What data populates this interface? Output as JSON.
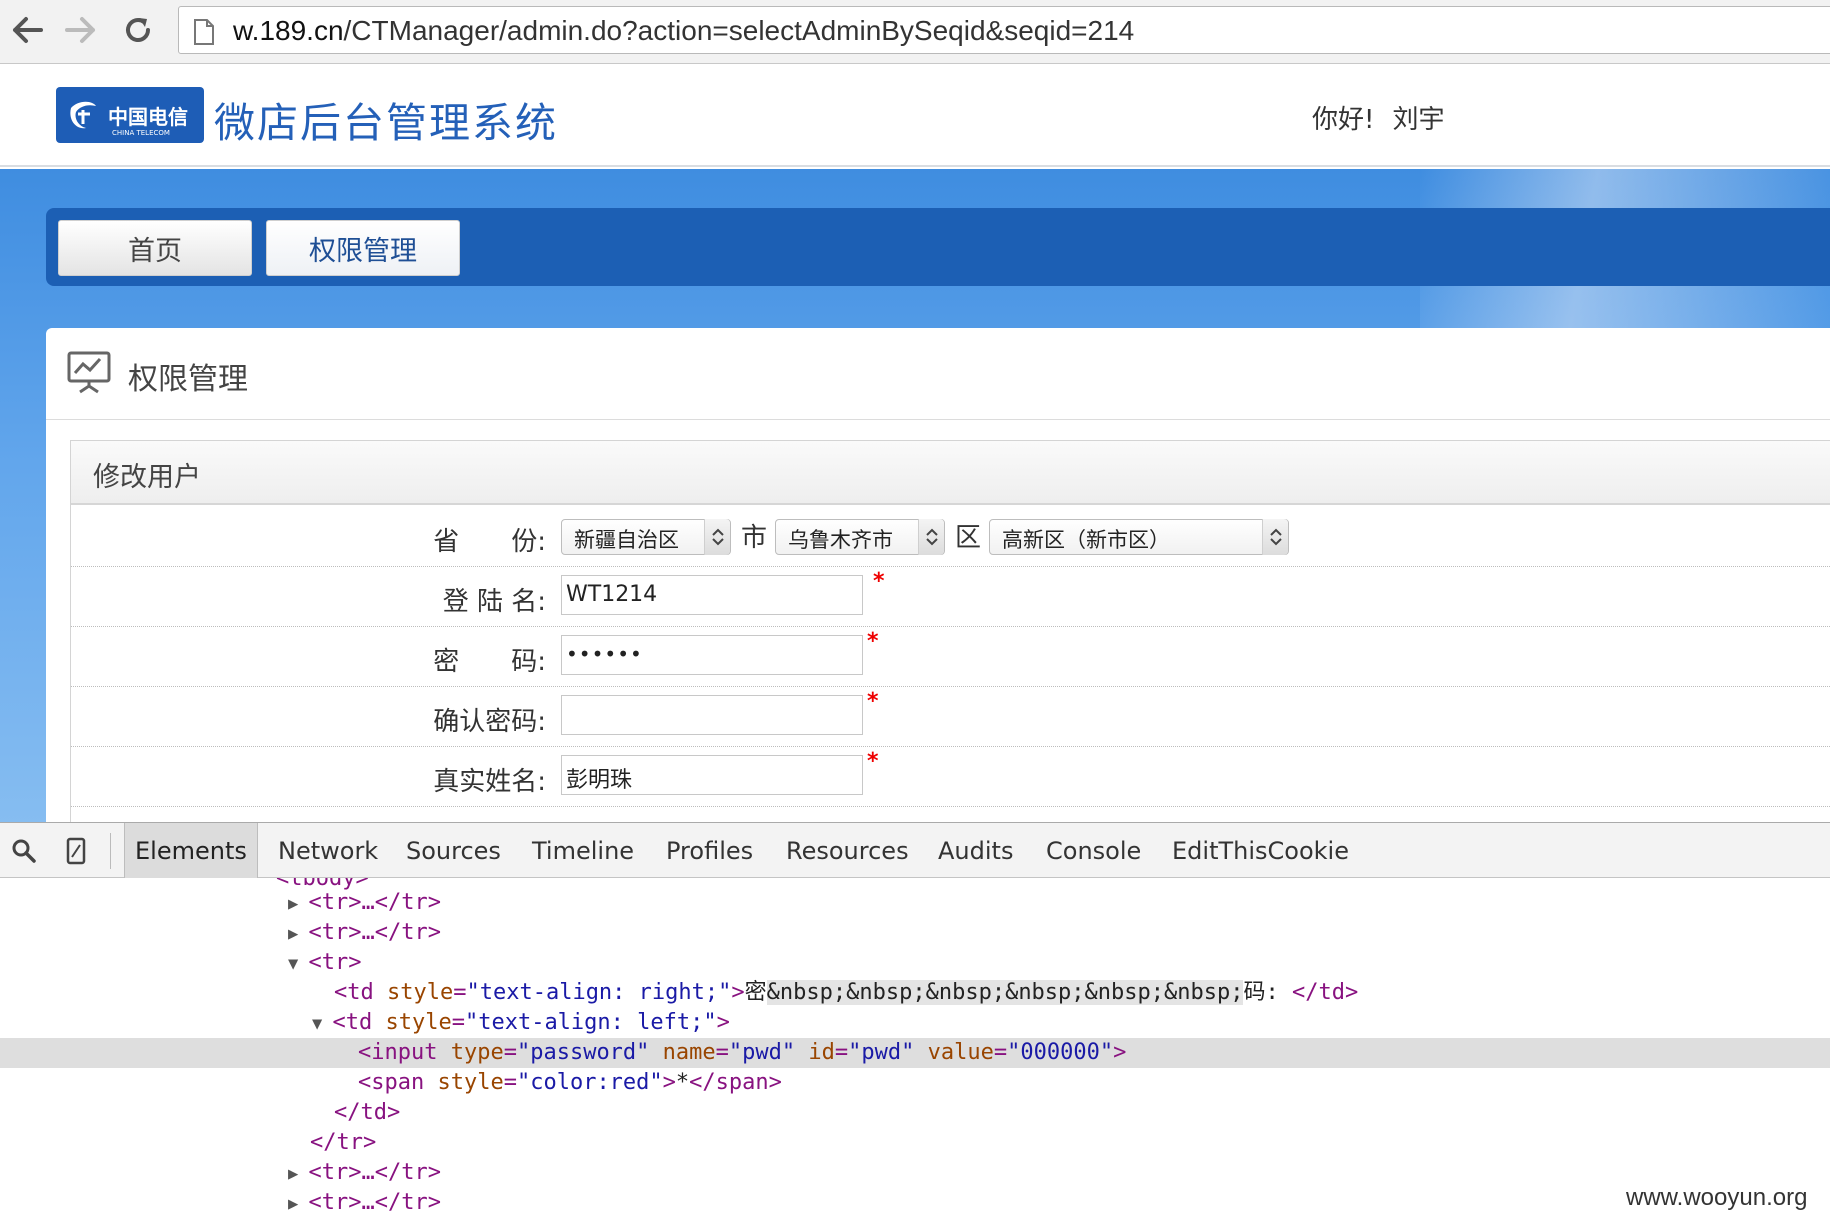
{
  "browser": {
    "url_host": "w.189.cn",
    "url_path": "/CTManager/admin.do?action=selectAdminBySeqid&seqid=214"
  },
  "site": {
    "logo_text": "中国电信",
    "logo_text_en": "CHINA TELECOM",
    "title": "微店后台管理系统",
    "greeting": "你好!",
    "user_name": "刘宇"
  },
  "nav": {
    "tabs": [
      {
        "label": "首页"
      },
      {
        "label": "权限管理"
      }
    ]
  },
  "panel": {
    "title": "权限管理",
    "section_title": "修改用户"
  },
  "form": {
    "province_label": "省　　份:",
    "province_value": "新疆自治区",
    "city_sep": "市",
    "city_value": "乌鲁木齐市",
    "district_sep": "区",
    "district_value": "高新区（新市区）",
    "login_label": "登 陆 名:",
    "login_value": "WT1214",
    "password_label": "密　　码:",
    "password_value": "••••••",
    "confirm_label": "确认密码:",
    "confirm_value": "",
    "realname_label": "真实姓名:",
    "realname_value": "彭明珠",
    "required_mark": "*"
  },
  "devtools": {
    "tabs": [
      "Elements",
      "Network",
      "Sources",
      "Timeline",
      "Profiles",
      "Resources",
      "Audits",
      "Console",
      "EditThisCookie"
    ],
    "active_tab": "Elements",
    "code": {
      "tbody_partial": "<tbody>",
      "tr_collapsed": "<tr>…</tr>",
      "tr_open": "<tr>",
      "td_right_open": "<td",
      "style_attr": "style",
      "td_right_style": "\"text-align: right;\"",
      "td_right_text1": "密",
      "td_right_nbsp": "&nbsp;&nbsp;&nbsp;&nbsp;&nbsp;&nbsp;",
      "td_right_text2": "码:",
      "td_close": "</td>",
      "td_left_style": "\"text-align: left;\"",
      "input_open": "<input",
      "type_attr": "type",
      "type_val": "\"password\"",
      "name_attr": "name",
      "name_val": "\"pwd\"",
      "id_attr": "id",
      "id_val": "\"pwd\"",
      "value_attr": "value",
      "value_val": "\"000000\"",
      "span_open": "<span",
      "span_style": "\"color:red\"",
      "span_text": "*",
      "span_close": "</span>",
      "tr_close": "</tr>"
    }
  },
  "watermark": "www.wooyun.org",
  "colors": {
    "brand_blue": "#1e5db6",
    "nav_blue": "#1c5fb4",
    "required_red": "#e00000"
  }
}
